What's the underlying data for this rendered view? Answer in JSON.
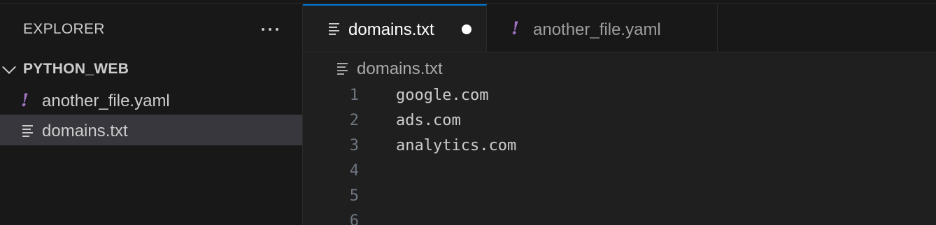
{
  "sidebar": {
    "title": "EXPLORER",
    "more_actions": "···",
    "folder": "PYTHON_WEB",
    "files": [
      {
        "name": "another_file.yaml",
        "icon": "yaml-icon",
        "icon_glyph": "!",
        "icon_color": "#a074c4"
      },
      {
        "name": "domains.txt",
        "icon": "text-file-icon",
        "selected": true
      }
    ]
  },
  "tabs": [
    {
      "label": "domains.txt",
      "icon": "text-file-icon",
      "active": true,
      "dirty": true
    },
    {
      "label": "another_file.yaml",
      "icon": "yaml-icon",
      "icon_glyph": "!",
      "active": false
    }
  ],
  "breadcrumb": {
    "label": "domains.txt",
    "icon": "text-file-icon"
  },
  "editor": {
    "lines": [
      {
        "number": "1",
        "text": "google.com"
      },
      {
        "number": "2",
        "text": "ads.com"
      },
      {
        "number": "3",
        "text": "analytics.com"
      },
      {
        "number": "4",
        "text": ""
      },
      {
        "number": "5",
        "text": ""
      },
      {
        "number": "6",
        "text": ""
      }
    ]
  },
  "colors": {
    "accent": "#0078d4",
    "sidebar_bg": "#181818",
    "editor_bg": "#1f1f1f",
    "selected_row": "#37373d",
    "yaml_icon": "#a074c4"
  }
}
